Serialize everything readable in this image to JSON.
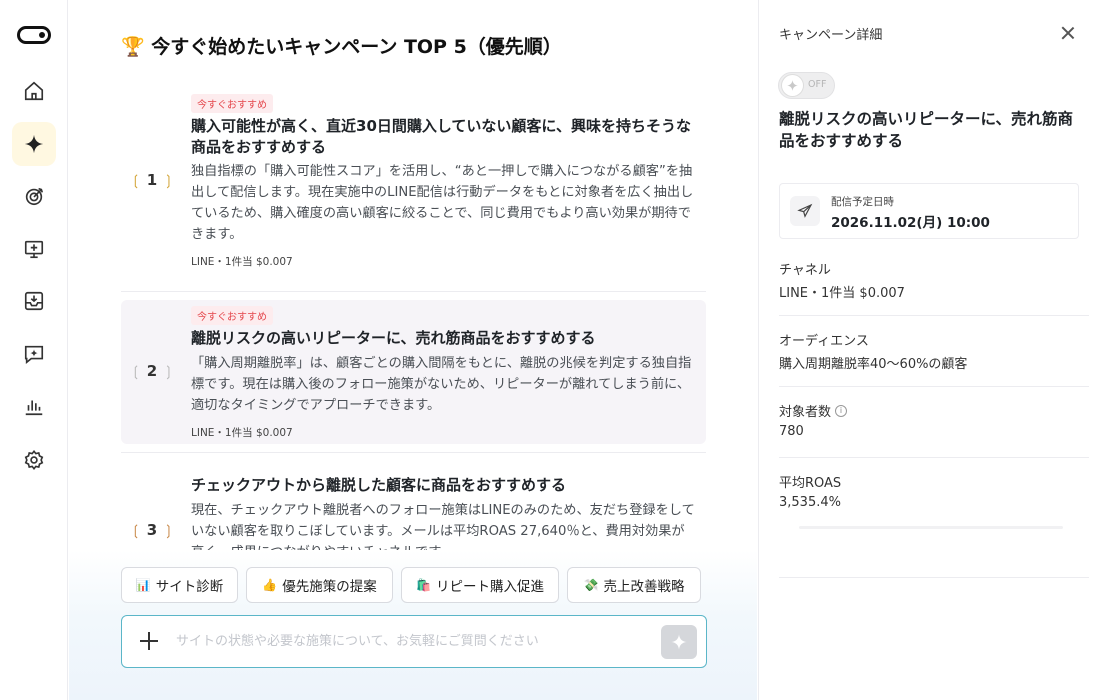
{
  "main": {
    "title": "🏆 今すぐ始めたいキャンペーン TOP 5（優先順）",
    "campaigns": [
      {
        "rank": "1",
        "badge": "今すぐおすすめ",
        "title": "購入可能性が高く、直近30日間購入していない顧客に、興味を持ちそうな商品をおすすめする",
        "description": "独自指標の「購入可能性スコア」を活用し、“あと一押しで購入につながる顧客”を抽出して配信します。現在実施中のLINE配信は行動データをもとに対象者を広く抽出しているため、購入確度の高い顧客に絞ることで、同じ費用でもより高い効果が期待できます。",
        "meta": "LINE・1件当 $0.007"
      },
      {
        "rank": "2",
        "badge": "今すぐおすすめ",
        "title": "離脱リスクの高いリピーターに、売れ筋商品をおすすめする",
        "description": "「購入周期離脱率」は、顧客ごとの購入間隔をもとに、離脱の兆候を判定する独自指標です。現在は購入後のフォロー施策がないため、リピーターが離れてしまう前に、適切なタイミングでアプローチできます。",
        "meta": "LINE・1件当 $0.007"
      },
      {
        "rank": "3",
        "title": "チェックアウトから離脱した顧客に商品をおすすめする",
        "description": "現在、チェックアウト離脱者へのフォロー施策はLINEのみのため、友だち登録をしていない顧客を取りこぼしています。メールは平均ROAS 27,640％と、費用対効果が高く、成果につながりやすいチャネルです。"
      }
    ],
    "chips": [
      {
        "emoji": "📊",
        "label": "サイト診断"
      },
      {
        "emoji": "👍",
        "label": "優先施策の提案"
      },
      {
        "emoji": "🛍️",
        "label": "リピート購入促進"
      },
      {
        "emoji": "💸",
        "label": "売上改善戦略"
      }
    ],
    "input_placeholder": "サイトの状態や必要な施策について、お気軽にご質問ください"
  },
  "panel": {
    "header": "キャンペーン詳細",
    "toggle_label": "OFF",
    "title": "離脱リスクの高いリピーターに、売れ筋商品をおすすめする",
    "schedule_label": "配信予定日時",
    "schedule_value": "2026.11.02(月) 10:00",
    "channel_label": "チャネル",
    "channel_value": "LINE・1件当 $0.007",
    "audience_label": "オーディエンス",
    "audience_value": "購入周期離脱率40〜60%の顧客",
    "target_label": "対象者数",
    "target_value": "780",
    "roas_label": "平均ROAS",
    "roas_value": "3,535.4%"
  },
  "colors": {
    "accent_active_bg": "#fff8e1",
    "badge_red": "#e5484d",
    "input_border": "#5bb6c8"
  }
}
